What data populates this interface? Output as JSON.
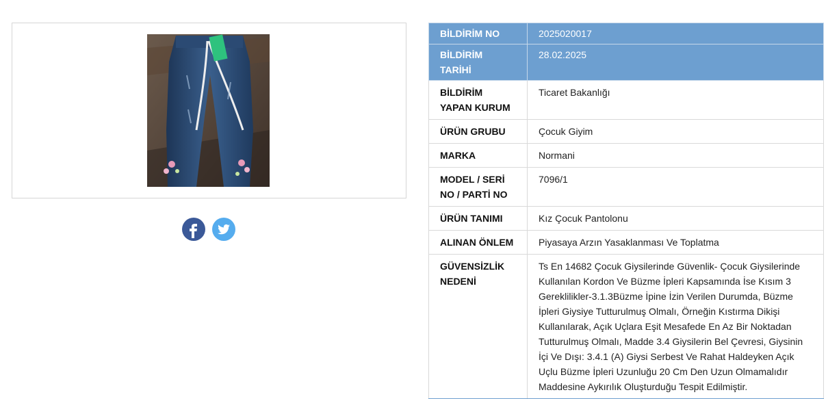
{
  "product_image_alt": "Kız çocuk kot pantolon",
  "social": {
    "facebook_icon": "facebook-icon",
    "twitter_icon": "twitter-icon",
    "facebook_color": "#3b5998",
    "twitter_color": "#55acee"
  },
  "colors": {
    "header_row_bg": "#6d9fd0"
  },
  "rows": [
    {
      "label": "BİLDİRİM NO",
      "value": "2025020017"
    },
    {
      "label": "BİLDİRİM TARİHİ",
      "value": "28.02.2025"
    },
    {
      "label": "BİLDİRİM YAPAN KURUM",
      "value": "Ticaret Bakanlığı"
    },
    {
      "label": "ÜRÜN GRUBU",
      "value": "Çocuk Giyim"
    },
    {
      "label": "MARKA",
      "value": "Normani"
    },
    {
      "label": "MODEL / SERİ NO / PARTİ NO",
      "value": "7096/1"
    },
    {
      "label": "ÜRÜN TANIMI",
      "value": "Kız Çocuk Pantolonu"
    },
    {
      "label": "ALINAN ÖNLEM",
      "value": "Piyasaya Arzın Yasaklanması Ve Toplatma"
    },
    {
      "label": "GÜVENSİZLİK NEDENİ",
      "value": "Ts En 14682 Çocuk Giysilerinde Güvenlik- Çocuk Giysilerinde Kullanılan Kordon Ve Büzme İpleri Kapsamında İse Kısım 3 Gereklilikler-3.1.3Büzme İpine İzin Verilen Durumda, Büzme İpleri Giysiye Tutturulmuş Olmalı, Örneğin Kıstırma Dikişi Kullanılarak, Açık Uçlara Eşit Mesafede En Az Bir Noktadan Tutturulmuş Olmalı, Madde 3.4 Giysilerin Bel Çevresi, Giysinin İçi Ve Dışı: 3.4.1 (A) Giysi Serbest Ve Rahat Haldeyken Açık Uçlu Büzme İpleri Uzunluğu 20 Cm Den Uzun Olmamalıdır Maddesine Aykırılık Oluşturduğu Tespit Edilmiştir."
    }
  ]
}
